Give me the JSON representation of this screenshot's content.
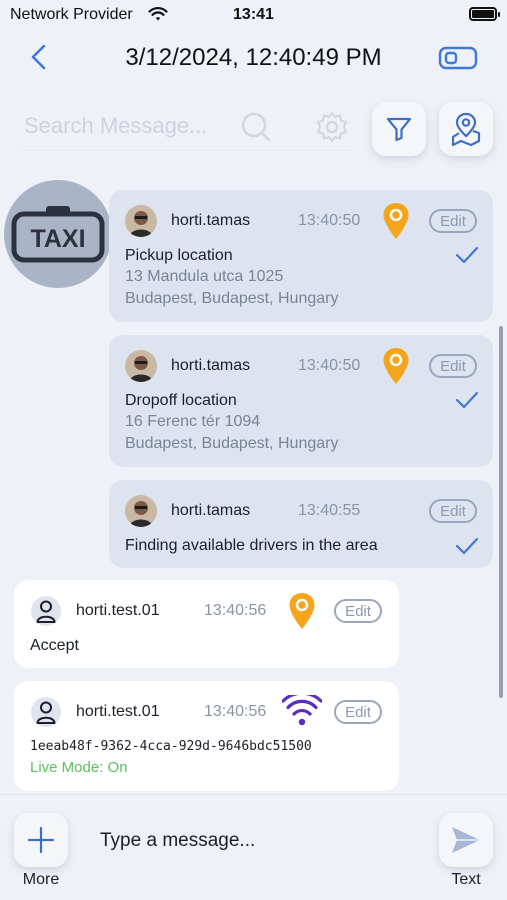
{
  "status_bar": {
    "carrier": "Network Provider",
    "time": "13:41",
    "wifi_icon": "wifi-icon",
    "battery_icon": "battery-icon"
  },
  "header": {
    "title": "3/12/2024, 12:40:49 PM",
    "back_icon": "chevron-left-icon",
    "right_icon": "toggle-switch-icon"
  },
  "search": {
    "placeholder": "Search Message...",
    "value": ""
  },
  "toolbar": {
    "settings_icon": "gear-icon",
    "filter_icon": "filter-icon",
    "map_icon": "map-pin-icon"
  },
  "channel_avatar": {
    "text": "TAXI"
  },
  "messages": [
    {
      "user": "horti.tamas",
      "time": "13:40:50",
      "edit_label": "Edit",
      "icon": "location-pin-icon",
      "title": "Pickup location",
      "address_line1": "13 Mandula utca 1025",
      "address_line2": "Budapest, Budapest, Hungary",
      "status": "sent-check"
    },
    {
      "user": "horti.tamas",
      "time": "13:40:50",
      "edit_label": "Edit",
      "icon": "location-pin-icon",
      "title": "Dropoff location",
      "address_line1": "16 Ferenc tér 1094",
      "address_line2": "Budapest, Budapest, Hungary",
      "status": "sent-check"
    },
    {
      "user": "horti.tamas",
      "time": "13:40:55",
      "edit_label": "Edit",
      "text": "Finding available drivers in the area",
      "status": "sent-check"
    },
    {
      "user": "horti.test.01",
      "time": "13:40:56",
      "edit_label": "Edit",
      "icon": "location-pin-icon",
      "text": "Accept"
    },
    {
      "user": "horti.test.01",
      "time": "13:40:56",
      "edit_label": "Edit",
      "icon": "wifi-signal-icon",
      "text": "1eeab48f-9362-4cca-929d-9646bdc51500",
      "live_text": "Live Mode: On"
    }
  ],
  "composer": {
    "placeholder": "Type a message...",
    "more_label": "More",
    "send_label": "Text"
  },
  "colors": {
    "background": "#eef1f7",
    "own_bubble": "#dde3ef",
    "other_bubble": "#ffffff",
    "accent_blue": "#3f79d8",
    "pin_orange": "#f4a51c",
    "wifi_purple": "#5b2bc7",
    "live_green": "#5cc15c"
  }
}
